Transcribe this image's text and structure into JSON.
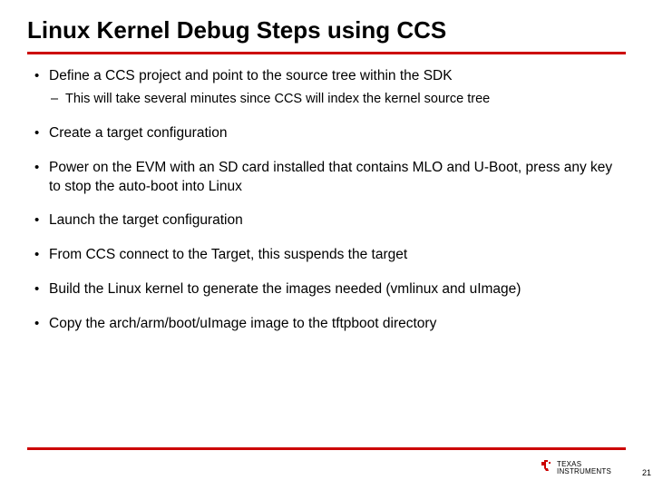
{
  "title": "Linux Kernel Debug Steps using CCS",
  "bullets": [
    {
      "text": "Define a CCS project and point to the source tree within the SDK",
      "sub": [
        "This will take several minutes since CCS will index the kernel source tree"
      ]
    },
    {
      "text": "Create a target configuration"
    },
    {
      "text": "Power on the EVM with an SD card installed that contains MLO and U-Boot, press any key to stop the auto-boot into Linux"
    },
    {
      "text": "Launch the target configuration"
    },
    {
      "text": "From CCS connect to the Target, this suspends the target"
    },
    {
      "text": "Build the Linux kernel to generate the images needed (vmlinux and uImage)"
    },
    {
      "text": "Copy the arch/arm/boot/uImage image to the tftpboot directory"
    }
  ],
  "logo": {
    "line1": "TEXAS",
    "line2": "INSTRUMENTS"
  },
  "page_number": "21",
  "colors": {
    "accent": "#cc0000"
  }
}
